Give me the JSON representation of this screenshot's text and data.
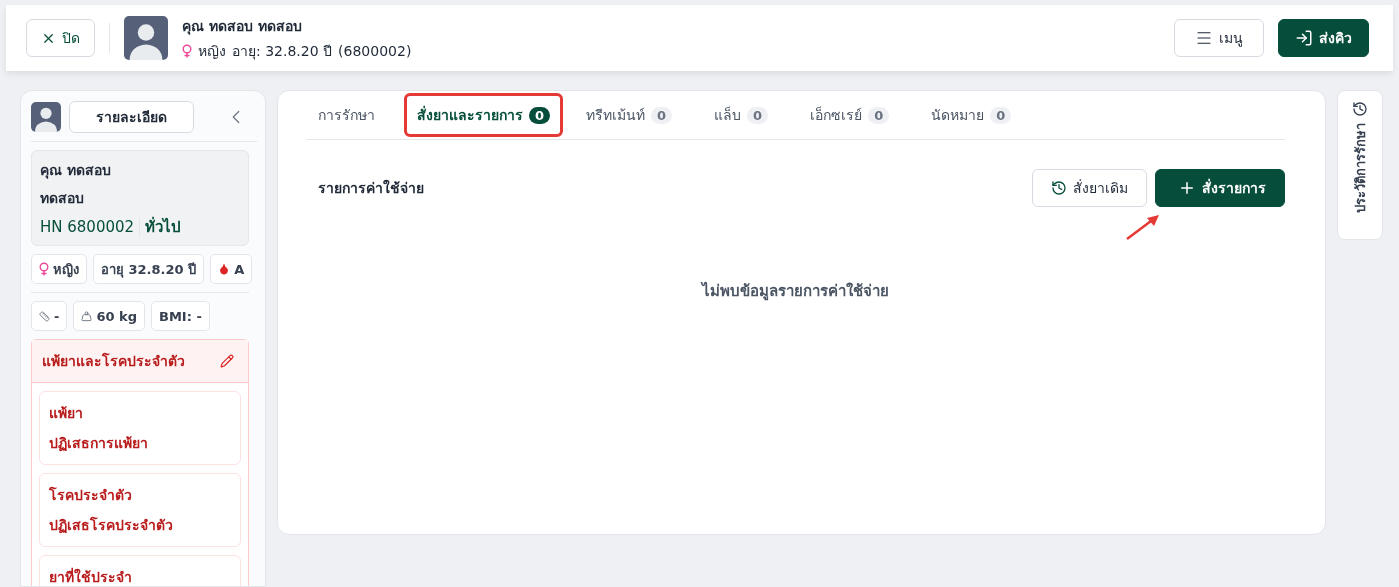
{
  "header": {
    "close_button": "ปิด",
    "patient_name": "คุณ ทดสอบ ทดสอบ",
    "gender": "หญิง",
    "age": "อายุ: 32.8.20 ปี",
    "patient_id": "(6800002)",
    "menu_button": "เมนู",
    "send_queue_button": "ส่งคิว"
  },
  "sidebar": {
    "details_button": "รายละเอียด",
    "name_line_1": "คุณ ทดสอบ",
    "name_line_2": "ทดสอบ",
    "hn": "HN 6800002",
    "patient_type": "ทั่วไป",
    "chips_row_1": [
      {
        "kind": "gender",
        "text": "หญิง"
      },
      {
        "kind": "plain",
        "text": "อายุ 32.8.20 ปี"
      },
      {
        "kind": "blood",
        "text": "A"
      }
    ],
    "chips_row_2": [
      {
        "kind": "height",
        "text": "-"
      },
      {
        "kind": "weight",
        "text": "60 kg"
      },
      {
        "kind": "plain",
        "text": "BMI: -"
      }
    ],
    "allergy_panel": {
      "title": "แพ้ยาและโรคประจำตัว",
      "cards": [
        {
          "title": "แพ้ยา",
          "value": "ปฏิเสธการแพ้ยา"
        },
        {
          "title": "โรคประจำตัว",
          "value": "ปฏิเสธโรคประจำตัว"
        },
        {
          "title": "ยาที่ใช้ประจำ"
        }
      ]
    }
  },
  "tabs": [
    {
      "label": "การรักษา",
      "selected": false,
      "highlighted": false
    },
    {
      "label": "สั่งยาและรายการ",
      "count": "0",
      "selected": true,
      "highlighted": true
    },
    {
      "label": "ทรีทเม้นท์",
      "count": "0",
      "selected": false,
      "highlighted": false
    },
    {
      "label": "แล็บ",
      "count": "0",
      "selected": false,
      "highlighted": false
    },
    {
      "label": "เอ็กซเรย์",
      "count": "0",
      "selected": false,
      "highlighted": false
    },
    {
      "label": "นัดหมาย",
      "count": "0",
      "selected": false,
      "highlighted": false
    }
  ],
  "section_title": "รายการค่าใช้จ่าย",
  "previous_order_button": "สั่งยาเดิม",
  "order_button": {
    "label": "สั่งรายการ",
    "pointed": true
  },
  "empty_message": "ไม่พบข้อมูลรายการค่าใช้จ่าย",
  "history_tab": "ประวัติการรักษา"
}
